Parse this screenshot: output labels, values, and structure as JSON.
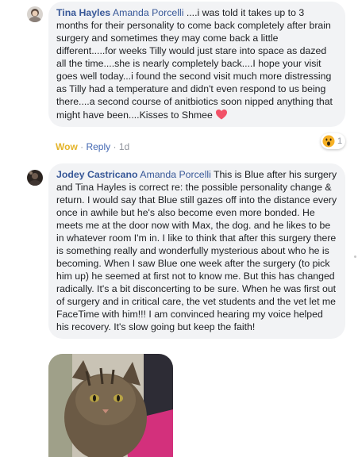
{
  "comments": [
    {
      "author": "Tina Hayles",
      "mention": "Amanda Porcelli",
      "text": " ....i was told it takes up to 3 months for their personality to come back completely after brain surgery and sometimes they may come back a little different.....for weeks Tilly would just stare into space as dazed all the time....she is nearly completely back....I hope your visit goes well today...i found the second visit much more distressing as Tilly had a temperature and didn't even respond to us being there....a second course of anitbiotics soon nipped anything that might have been....Kisses to Shmee ",
      "emoji": "heart-icon",
      "actions": {
        "reaction_label": "Wow",
        "reply_label": "Reply",
        "age": "1d",
        "separator": "·"
      },
      "reaction_count": "1",
      "reaction_icon": "wow-icon"
    },
    {
      "author": "Jodey Castricano",
      "mention": "Amanda Porcelli",
      "text": " This is Blue after his surgery and Tina Hayles is correct re: the possible personality change & return. I would say that Blue still gazes off into the distance every once in awhile but he's also become even more bonded. He meets me at the door now with Max, the dog. and he likes to be in whatever room I'm in. I like to think that after this surgery there is something really and wonderfully mysterious about who he is becoming. When I saw Blue one week after the surgery (to pick him up) he seemed at first not to know me. But this has changed radically. It's a bit disconcerting to be sure. When he was first out of surgery and in critical care, the vet students and the vet let me FaceTime with him!!! I am convinced hearing my voice helped his recovery. It's slow going but keep the faith!",
      "attachment": "cat-photo"
    }
  ],
  "colors": {
    "link": "#385898",
    "bubble": "#f2f3f5",
    "wow": "#e4b42a",
    "reply": "#4267b2",
    "meta": "#90949c",
    "heart": "#f25268"
  }
}
